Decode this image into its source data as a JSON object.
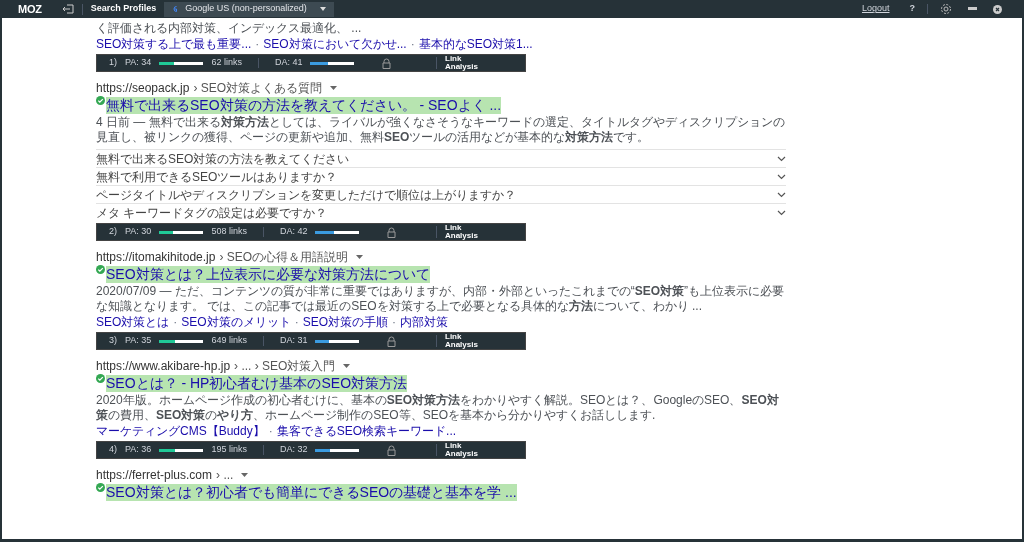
{
  "toolbar": {
    "logo": "MOZ",
    "search_profiles_label": "Search Profiles",
    "profile_select": "Google US (non-personalized)",
    "logout": "Logout",
    "help": "?"
  },
  "results": [
    {
      "snippet": "く評価される内部対策、インデックス最適化、 ...",
      "sitelinks": [
        {
          "kind": "link",
          "text": "SEO対策する上で最も重要..."
        },
        {
          "kind": "separator",
          "text": "·"
        },
        {
          "kind": "link",
          "text": "SEO対策において欠かせ..."
        },
        {
          "kind": "separator",
          "text": "·"
        },
        {
          "kind": "link",
          "text": "基本的なSEO対策1..."
        }
      ],
      "moz": {
        "rank": "1)",
        "pa": "PA: 34",
        "pa_meter": {
          "level": 0.34
        },
        "links": "62 links",
        "da": "DA: 41",
        "da_meter": {
          "level": 0.41
        },
        "link_analysis": "Link Analysis"
      }
    },
    {
      "url": "https://seopack.jp",
      "breadcrumb": "› SEO対策よくある質問",
      "title": "無料で出来るSEO対策の方法を教えてください。 - SEOよく ...",
      "snippet": "4 日前 — 無料で出来る**対策方法**としては、ライバルが強くなさそうなキーワードの選定、タイトルタグやディスクリプションの見直し、被リンクの獲得、ページの更新や追加、無料**SEO**ツールの活用などが基本的な**対策方法**です。",
      "faqs": [
        {
          "text": "無料で出来るSEO対策の方法を教えてください",
          "expanded": false
        },
        {
          "text": "無料で利用できるSEOツールはありますか？",
          "expanded": false
        },
        {
          "text": "ページタイトルやディスクリプションを変更しただけで順位は上がりますか？",
          "expanded": false
        },
        {
          "text": "メタ キーワードタグの設定は必要ですか？",
          "expanded": false
        }
      ],
      "moz": {
        "rank": "2)",
        "pa": "PA: 30",
        "pa_meter": {
          "level": 0.3
        },
        "links": "508 links",
        "da": "DA: 42",
        "da_meter": {
          "level": 0.42
        },
        "link_analysis": "Link Analysis"
      }
    },
    {
      "url": "https://itomakihitode.jp",
      "breadcrumb": "› SEOの心得＆用語説明",
      "title": "SEO対策とは？上位表示に必要な対策方法について",
      "snippet": "2020/07/09 — ただ、コンテンツの質が非常に重要ではありますが、内部・外部といったこれまでの“**SEO対策**”も上位表示に必要な知識となります。 では、この記事では最近のSEOを対策する上で必要となる具体的な**方法**について、わかり ...",
      "sitelinks": [
        {
          "kind": "link",
          "text": "SEO対策とは"
        },
        {
          "kind": "separator",
          "text": "·"
        },
        {
          "kind": "link",
          "text": "SEO対策のメリット"
        },
        {
          "kind": "separator",
          "text": "·"
        },
        {
          "kind": "link",
          "text": "SEO対策の手順"
        },
        {
          "kind": "separator",
          "text": "·"
        },
        {
          "kind": "link",
          "text": "内部対策"
        }
      ],
      "moz": {
        "rank": "3)",
        "pa": "PA: 35",
        "pa_meter": {
          "level": 0.35
        },
        "links": "649 links",
        "da": "DA: 31",
        "da_meter": {
          "level": 0.31
        },
        "link_analysis": "Link Analysis"
      }
    },
    {
      "url": "https://www.akibare-hp.jp",
      "breadcrumb": "› ... › SEO対策入門",
      "title": "SEOとは？ - HP初心者むけ基本のSEO対策方法",
      "snippet": "2020年版。ホームページ作成の初心者むけに、基本の**SEO対策方法**をわかりやすく解説。SEOとは？、GoogleのSEO、**SEO対策**の費用、**SEO対策**の**やり方**、ホームページ制作のSEO等、SEOを基本から分かりやすくお話しします.",
      "sitelinks": [
        {
          "kind": "link",
          "text": "マーケティングCMS【Buddy】"
        },
        {
          "kind": "separator",
          "text": "·"
        },
        {
          "kind": "link",
          "text": "集客できるSEO検索キーワード..."
        }
      ],
      "moz": {
        "rank": "4)",
        "pa": "PA: 36",
        "pa_meter": {
          "level": 0.36
        },
        "links": "195 links",
        "da": "DA: 32",
        "da_meter": {
          "level": 0.32
        },
        "link_analysis": "Link Analysis"
      }
    },
    {
      "url": "https://ferret-plus.com",
      "breadcrumb": "› ...",
      "title": "SEO対策とは？初心者でも簡単にできるSEOの基礎と基本を学 ..."
    }
  ]
}
